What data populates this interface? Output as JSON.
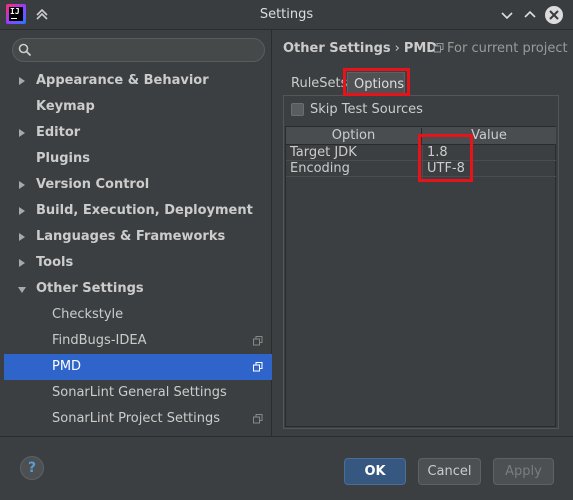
{
  "window": {
    "title": "Settings"
  },
  "search": {
    "placeholder": "",
    "value": ""
  },
  "sidebar": {
    "items": [
      {
        "label": "Appearance & Behavior",
        "expandable": true,
        "expanded": false
      },
      {
        "label": "Keymap",
        "expandable": false
      },
      {
        "label": "Editor",
        "expandable": true,
        "expanded": false
      },
      {
        "label": "Plugins",
        "expandable": false
      },
      {
        "label": "Version Control",
        "expandable": true,
        "expanded": false
      },
      {
        "label": "Build, Execution, Deployment",
        "expandable": true,
        "expanded": false
      },
      {
        "label": "Languages & Frameworks",
        "expandable": true,
        "expanded": false
      },
      {
        "label": "Tools",
        "expandable": true,
        "expanded": false
      },
      {
        "label": "Other Settings",
        "expandable": true,
        "expanded": true
      },
      {
        "label": "Checkstyle",
        "child": true
      },
      {
        "label": "FindBugs-IDEA",
        "child": true,
        "project_icon": true
      },
      {
        "label": "PMD",
        "child": true,
        "selected": true,
        "project_icon": true
      },
      {
        "label": "SonarLint General Settings",
        "child": true
      },
      {
        "label": "SonarLint Project Settings",
        "child": true,
        "project_icon": true
      }
    ]
  },
  "breadcrumb": {
    "parent": "Other Settings",
    "separator": "›",
    "current": "PMD"
  },
  "scope_hint": {
    "icon": "project-icon",
    "label": "For current project"
  },
  "tabs": [
    {
      "label": "RuleSets",
      "active": false
    },
    {
      "label": "Options",
      "active": true
    }
  ],
  "options": {
    "skip_test_sources": {
      "label": "Skip Test Sources",
      "checked": false
    },
    "table": {
      "headers": [
        "Option",
        "Value"
      ],
      "rows": [
        {
          "option": "Target JDK",
          "value": "1.8"
        },
        {
          "option": "Encoding",
          "value": "UTF-8"
        }
      ]
    }
  },
  "buttons": {
    "help": "?",
    "ok": "OK",
    "cancel": "Cancel",
    "apply": "Apply"
  },
  "colors": {
    "background": "#3c3f41",
    "selection": "#2f65ca",
    "highlight_annotation": "#e8121b",
    "ok_button": "#365880"
  }
}
